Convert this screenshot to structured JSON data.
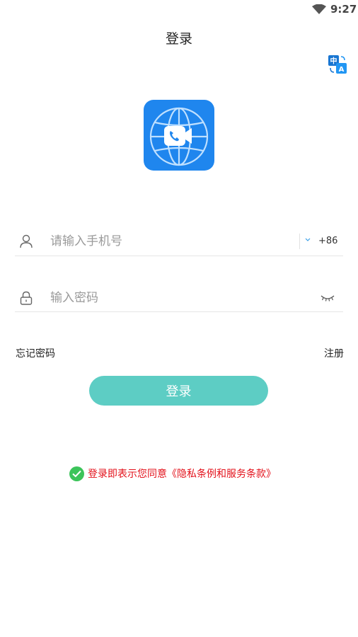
{
  "status_bar": {
    "time": "9:27"
  },
  "header": {
    "title": "登录"
  },
  "form": {
    "phone_placeholder": "请输入手机号",
    "country_code": "+86",
    "password_placeholder": "输入密码"
  },
  "links": {
    "forgot": "忘记密码",
    "register": "注册"
  },
  "login_button": "登录",
  "agreement": "登录即表示您同意《隐私条例和服务条款》",
  "colors": {
    "primary": "#5dcdc4",
    "agreement": "#e3101a",
    "check": "#3cc45a",
    "app_icon": "#1f86ee"
  },
  "icons": [
    "wifi-icon",
    "translate-icon",
    "app-logo-icon",
    "user-icon",
    "chevron-down-icon",
    "lock-icon",
    "eye-closed-icon",
    "check-circle-icon"
  ]
}
